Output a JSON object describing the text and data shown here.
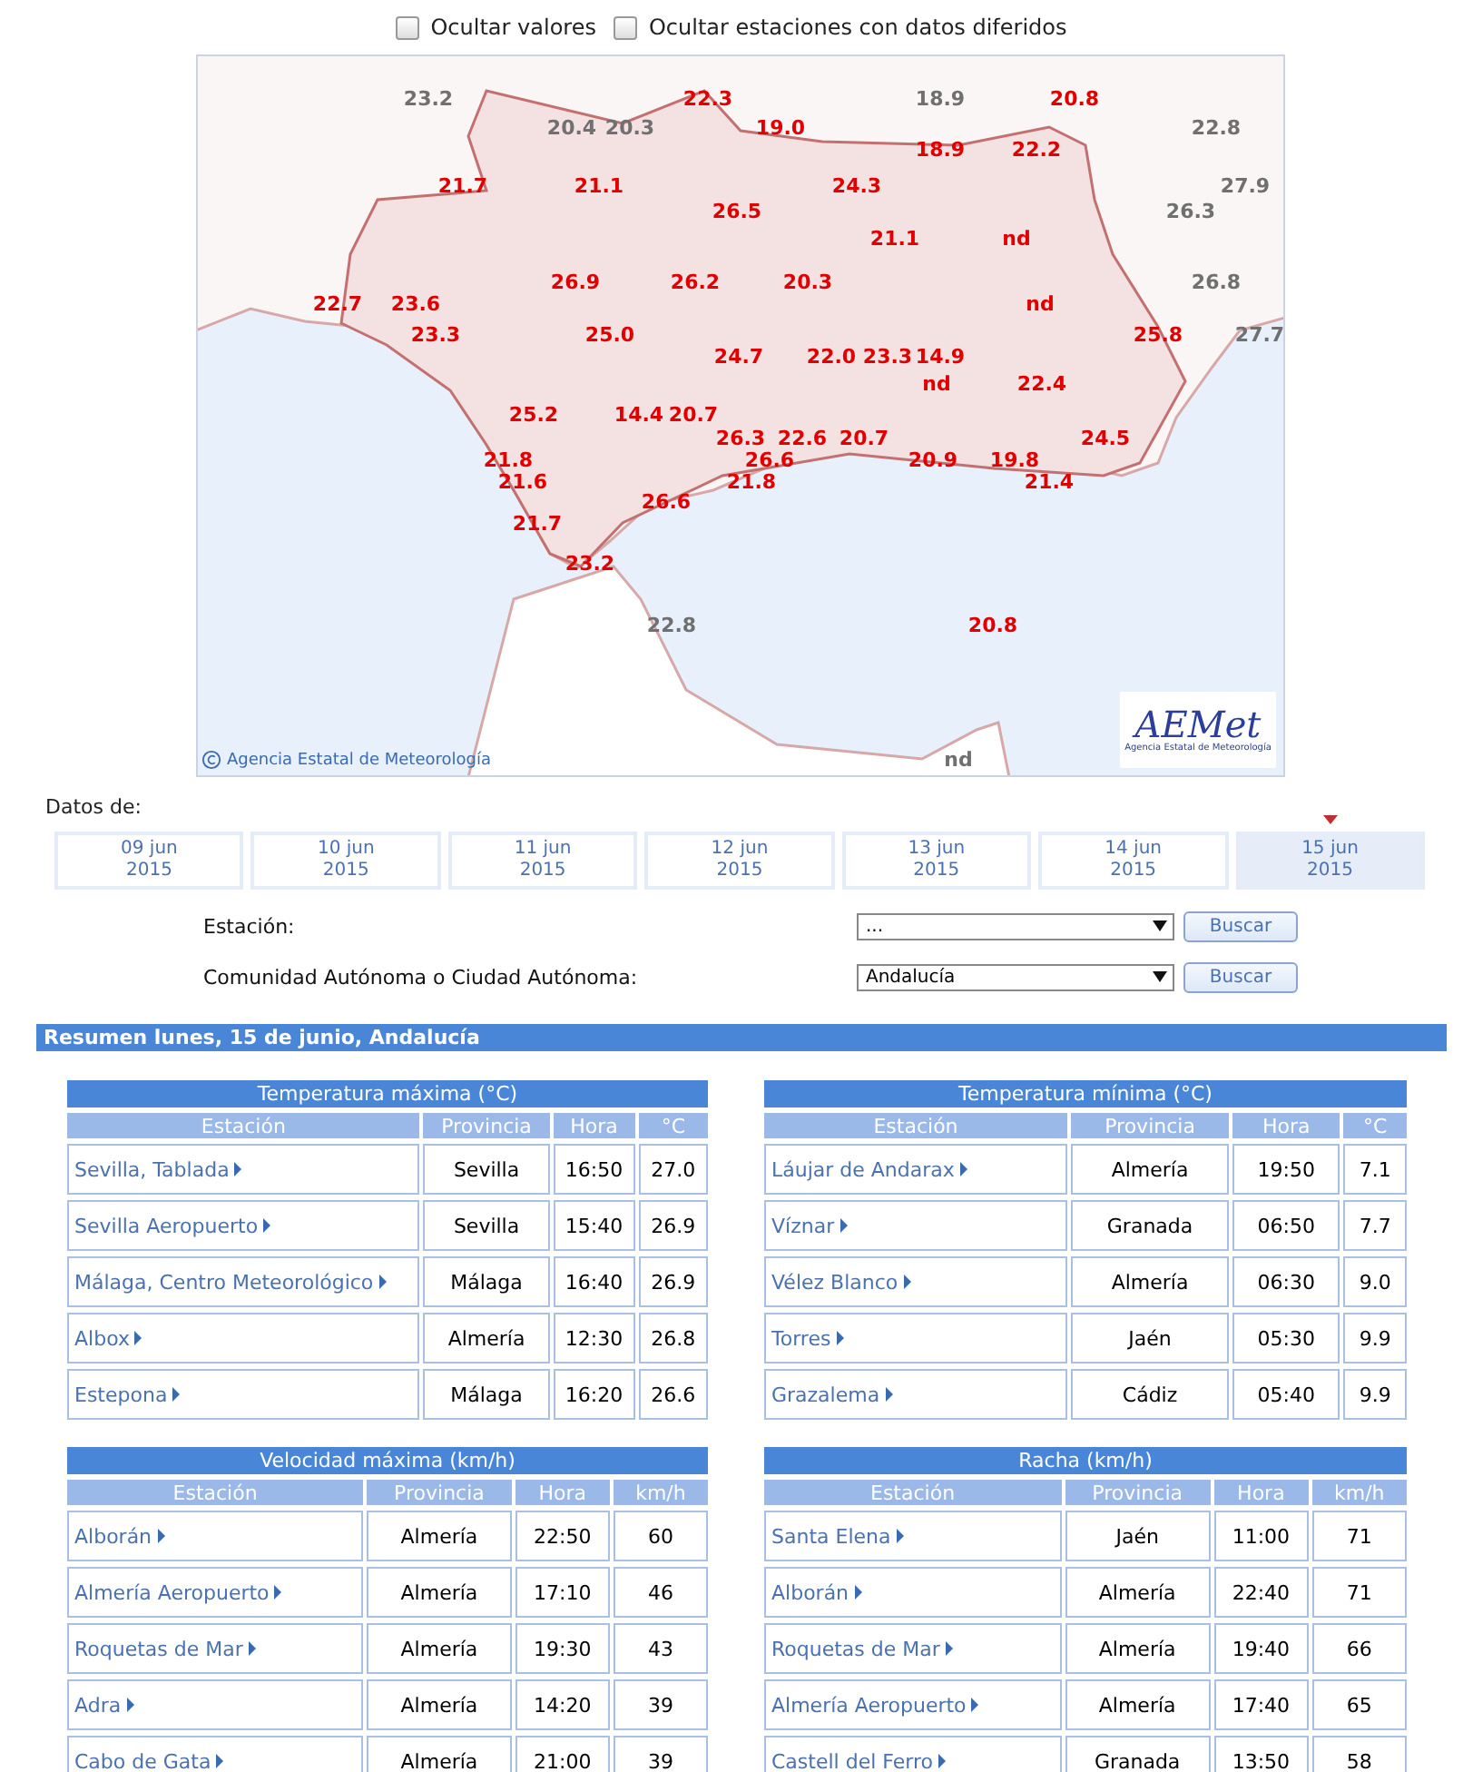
{
  "options": [
    {
      "label": "Ocultar valores",
      "checked": false
    },
    {
      "label": "Ocultar estaciones con datos diferidos",
      "checked": false
    }
  ],
  "map": {
    "credit": "Agencia Estatal de Meteorología",
    "logo": {
      "mark": "AEMet",
      "subtitle": "Agencia Estatal de Meteorología"
    },
    "labels": [
      {
        "text": "23.2",
        "color": "#707070"
      },
      {
        "text": "22.3",
        "color": "#e00000"
      },
      {
        "text": "18.9",
        "color": "#707070"
      },
      {
        "text": "20.8",
        "color": "#e00000"
      },
      {
        "text": "20.4",
        "color": "#707070"
      },
      {
        "text": "20.3",
        "color": "#707070"
      },
      {
        "text": "19.0",
        "color": "#e00000"
      },
      {
        "text": "22.8",
        "color": "#707070"
      },
      {
        "text": "18.9",
        "color": "#e00000"
      },
      {
        "text": "22.2",
        "color": "#e00000"
      },
      {
        "text": "21.7",
        "color": "#e00000"
      },
      {
        "text": "21.1",
        "color": "#e00000"
      },
      {
        "text": "24.3",
        "color": "#e00000"
      },
      {
        "text": "27.9",
        "color": "#707070"
      },
      {
        "text": "26.5",
        "color": "#e00000"
      },
      {
        "text": "26.3",
        "color": "#707070"
      },
      {
        "text": "21.1",
        "color": "#e00000"
      },
      {
        "text": "nd",
        "color": "#e00000"
      },
      {
        "text": "26.9",
        "color": "#e00000"
      },
      {
        "text": "26.2",
        "color": "#e00000"
      },
      {
        "text": "20.3",
        "color": "#e00000"
      },
      {
        "text": "26.8",
        "color": "#707070"
      },
      {
        "text": "22.7",
        "color": "#e00000"
      },
      {
        "text": "23.6",
        "color": "#e00000"
      },
      {
        "text": "nd",
        "color": "#e00000"
      },
      {
        "text": "23.3",
        "color": "#e00000"
      },
      {
        "text": "25.0",
        "color": "#e00000"
      },
      {
        "text": "25.8",
        "color": "#e00000"
      },
      {
        "text": "27.7",
        "color": "#707070"
      },
      {
        "text": "24.7",
        "color": "#e00000"
      },
      {
        "text": "22.0",
        "color": "#e00000"
      },
      {
        "text": "23.3",
        "color": "#e00000"
      },
      {
        "text": "14.9",
        "color": "#e00000"
      },
      {
        "text": "nd",
        "color": "#e00000"
      },
      {
        "text": "22.4",
        "color": "#e00000"
      },
      {
        "text": "25.2",
        "color": "#e00000"
      },
      {
        "text": "14.4",
        "color": "#e00000"
      },
      {
        "text": "20.7",
        "color": "#e00000"
      },
      {
        "text": "26.3",
        "color": "#e00000"
      },
      {
        "text": "22.6",
        "color": "#e00000"
      },
      {
        "text": "20.7",
        "color": "#e00000"
      },
      {
        "text": "24.5",
        "color": "#e00000"
      },
      {
        "text": "21.8",
        "color": "#e00000"
      },
      {
        "text": "26.6",
        "color": "#e00000"
      },
      {
        "text": "20.9",
        "color": "#e00000"
      },
      {
        "text": "19.8",
        "color": "#e00000"
      },
      {
        "text": "21.6",
        "color": "#e00000"
      },
      {
        "text": "21.8",
        "color": "#e00000"
      },
      {
        "text": "21.4",
        "color": "#e00000"
      },
      {
        "text": "26.6",
        "color": "#e00000"
      },
      {
        "text": "21.7",
        "color": "#e00000"
      },
      {
        "text": "23.2",
        "color": "#e00000"
      },
      {
        "text": "22.8",
        "color": "#707070"
      },
      {
        "text": "20.8",
        "color": "#e00000"
      },
      {
        "text": "nd",
        "color": "#707070"
      }
    ]
  },
  "dates_label": "Datos de:",
  "dates": [
    {
      "day": "09 jun",
      "year": "2015",
      "selected": false
    },
    {
      "day": "10 jun",
      "year": "2015",
      "selected": false
    },
    {
      "day": "11 jun",
      "year": "2015",
      "selected": false
    },
    {
      "day": "12 jun",
      "year": "2015",
      "selected": false
    },
    {
      "day": "13 jun",
      "year": "2015",
      "selected": false
    },
    {
      "day": "14 jun",
      "year": "2015",
      "selected": false
    },
    {
      "day": "15 jun",
      "year": "2015",
      "selected": true
    }
  ],
  "filters": [
    {
      "label": "Estación:",
      "value": "...",
      "button": "Buscar"
    },
    {
      "label": "Comunidad Autónoma o Ciudad Autónoma:",
      "value": "Andalucía",
      "button": "Buscar"
    }
  ],
  "summary_title": "Resumen lunes, 15 de junio, Andalucía",
  "tables": [
    {
      "title": "Temperatura máxima (°C)",
      "columns": [
        "Estación",
        "Provincia",
        "Hora",
        "°C"
      ],
      "rows": [
        [
          "Sevilla, Tablada",
          "Sevilla",
          "16:50",
          "27.0"
        ],
        [
          "Sevilla Aeropuerto",
          "Sevilla",
          "15:40",
          "26.9"
        ],
        [
          "Málaga, Centro Meteorológico",
          "Málaga",
          "16:40",
          "26.9"
        ],
        [
          "Albox",
          "Almería",
          "12:30",
          "26.8"
        ],
        [
          "Estepona",
          "Málaga",
          "16:20",
          "26.6"
        ]
      ]
    },
    {
      "title": "Temperatura mínima (°C)",
      "columns": [
        "Estación",
        "Provincia",
        "Hora",
        "°C"
      ],
      "rows": [
        [
          "Láujar de Andarax",
          "Almería",
          "19:50",
          "7.1"
        ],
        [
          "Víznar",
          "Granada",
          "06:50",
          "7.7"
        ],
        [
          "Vélez Blanco",
          "Almería",
          "06:30",
          "9.0"
        ],
        [
          "Torres",
          "Jaén",
          "05:30",
          "9.9"
        ],
        [
          "Grazalema",
          "Cádiz",
          "05:40",
          "9.9"
        ]
      ]
    },
    {
      "title": "Velocidad máxima (km/h)",
      "columns": [
        "Estación",
        "Provincia",
        "Hora",
        "km/h"
      ],
      "rows": [
        [
          "Alborán",
          "Almería",
          "22:50",
          "60"
        ],
        [
          "Almería Aeropuerto",
          "Almería",
          "17:10",
          "46"
        ],
        [
          "Roquetas de Mar",
          "Almería",
          "19:30",
          "43"
        ],
        [
          "Adra",
          "Almería",
          "14:20",
          "39"
        ],
        [
          "Cabo de Gata",
          "Almería",
          "21:00",
          "39"
        ]
      ]
    },
    {
      "title": "Racha (km/h)",
      "columns": [
        "Estación",
        "Provincia",
        "Hora",
        "km/h"
      ],
      "rows": [
        [
          "Santa Elena",
          "Jaén",
          "11:00",
          "71"
        ],
        [
          "Alborán",
          "Almería",
          "22:40",
          "71"
        ],
        [
          "Roquetas de Mar",
          "Almería",
          "19:40",
          "66"
        ],
        [
          "Almería Aeropuerto",
          "Almería",
          "17:40",
          "65"
        ],
        [
          "Castell del Ferro",
          "Granada",
          "13:50",
          "58"
        ]
      ]
    }
  ]
}
